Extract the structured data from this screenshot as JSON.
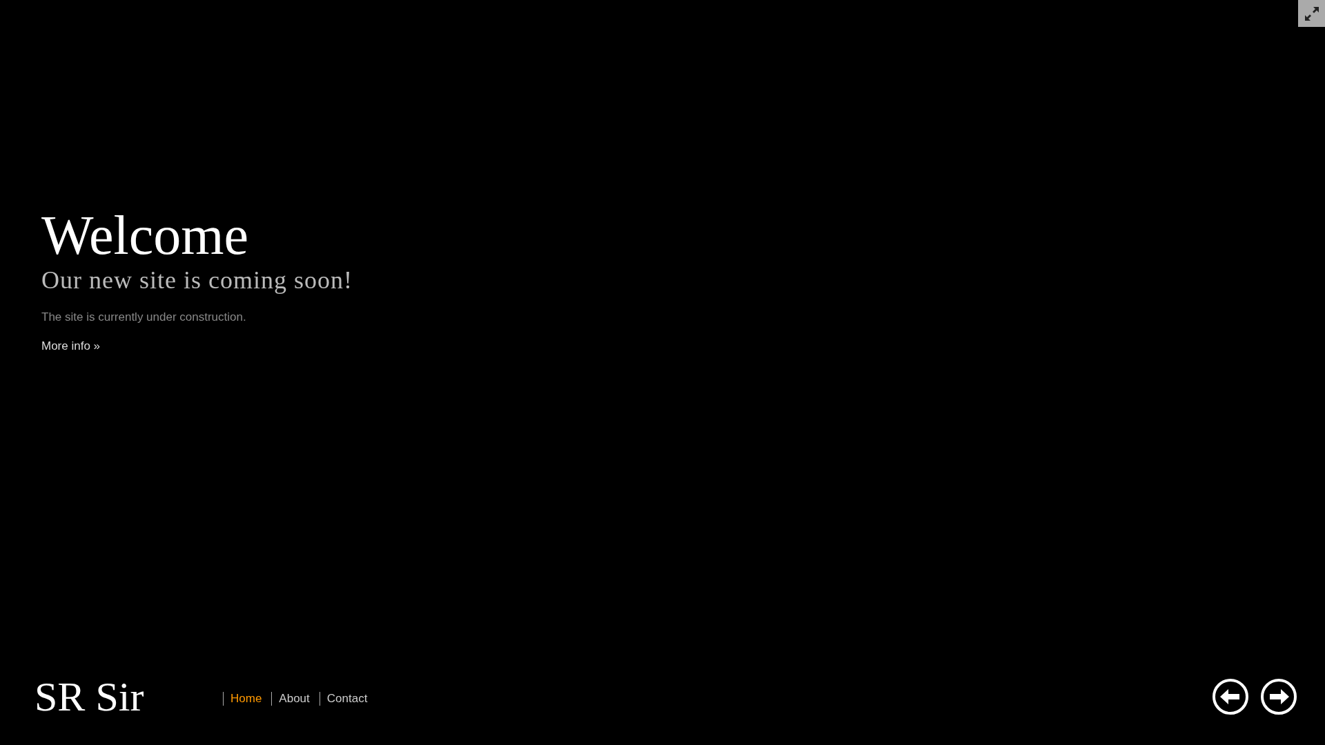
{
  "hero": {
    "title": "Welcome",
    "subtitle": "Our new site is coming soon!",
    "text": "The site is currently under construction.",
    "link": "More info »"
  },
  "footer": {
    "logo": "SR Sir",
    "nav": [
      {
        "label": "Home",
        "selected": true
      },
      {
        "label": "About",
        "selected": false
      },
      {
        "label": "Contact",
        "selected": false
      }
    ]
  }
}
